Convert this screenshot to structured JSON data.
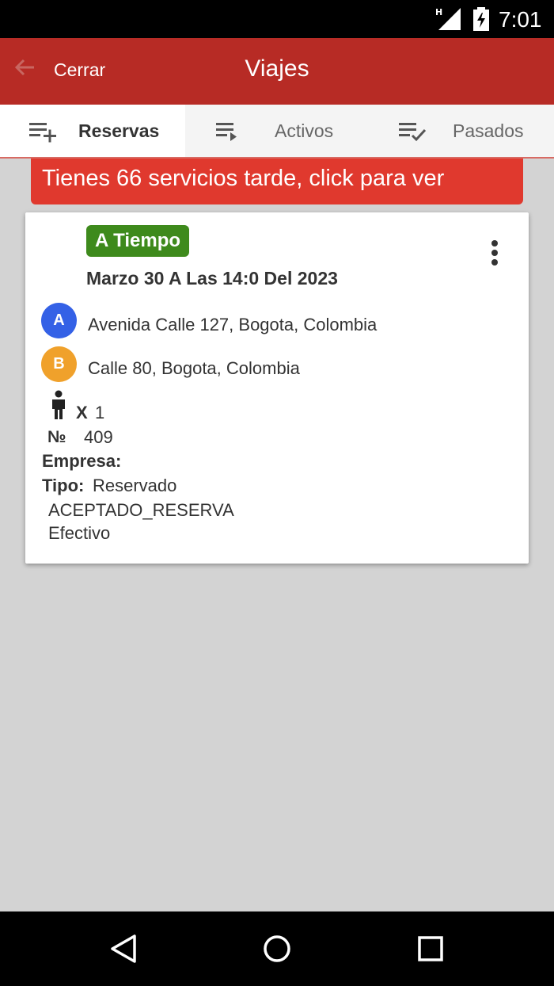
{
  "status_bar": {
    "network_label": "H",
    "time": "7:01",
    "network_icon": "signal-icon",
    "battery_icon": "battery-charging-icon"
  },
  "app_bar": {
    "back_icon": "arrow-back-icon",
    "close_label": "Cerrar",
    "title": "Viajes",
    "color": "#b72b25"
  },
  "tabs": [
    {
      "label": "Reservas",
      "icon": "playlist-add-icon",
      "active": true
    },
    {
      "label": "Activos",
      "icon": "playlist-play-icon",
      "active": false
    },
    {
      "label": "Pasados",
      "icon": "playlist-check-icon",
      "active": false
    }
  ],
  "late_banner": {
    "text": "Tienes 66 servicios tarde, click para ver",
    "color": "#e0392e"
  },
  "trip_card": {
    "status_badge": "A Tiempo",
    "status_color": "#3e8a1c",
    "date": "Marzo 30 A Las 14:0 Del 2023",
    "menu_icon": "more-vertical-icon",
    "origin": {
      "marker": "A",
      "address": "Avenida Calle 127, Bogota, Colombia",
      "color": "#3461e6"
    },
    "destination": {
      "marker": "B",
      "address": "Calle 80, Bogota, Colombia",
      "color": "#f0a12b"
    },
    "passengers": {
      "icon": "person-icon",
      "x_label": "X",
      "count": "1"
    },
    "number": {
      "symbol": "№",
      "value": "409"
    },
    "company": {
      "label": "Empresa:",
      "value": ""
    },
    "type": {
      "label": "Tipo:",
      "value": "Reservado"
    },
    "state": "ACEPTADO_RESERVA",
    "payment": "Efectivo"
  },
  "nav_bar": {
    "back_icon": "nav-back-icon",
    "home_icon": "nav-home-icon",
    "recents_icon": "nav-recents-icon"
  }
}
